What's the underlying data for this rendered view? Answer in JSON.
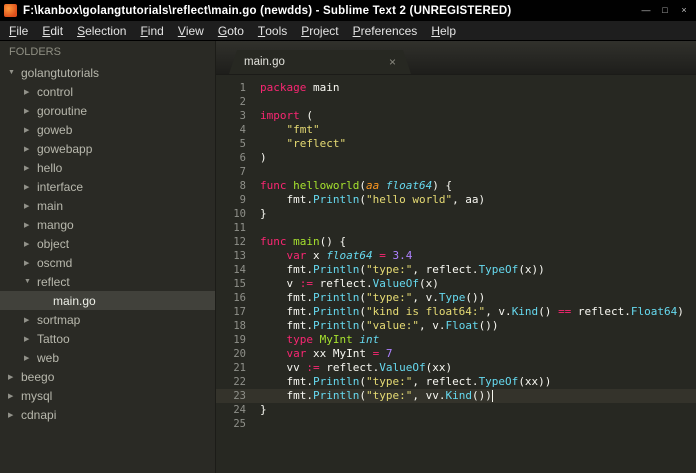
{
  "window": {
    "title": "F:\\kanbox\\golangtutorials\\reflect\\main.go (newdds) - Sublime Text 2 (UNREGISTERED)",
    "controls": {
      "minimize": "—",
      "maximize": "□",
      "close": "×"
    }
  },
  "menu": {
    "items": [
      "File",
      "Edit",
      "Selection",
      "Find",
      "View",
      "Goto",
      "Tools",
      "Project",
      "Preferences",
      "Help"
    ]
  },
  "sidebar": {
    "header": "FOLDERS",
    "items": [
      {
        "label": "golangtutorials",
        "depth": 0,
        "arrow": "down",
        "selected": false
      },
      {
        "label": "control",
        "depth": 1,
        "arrow": "right",
        "selected": false
      },
      {
        "label": "goroutine",
        "depth": 1,
        "arrow": "right",
        "selected": false
      },
      {
        "label": "goweb",
        "depth": 1,
        "arrow": "right",
        "selected": false
      },
      {
        "label": "gowebapp",
        "depth": 1,
        "arrow": "right",
        "selected": false
      },
      {
        "label": "hello",
        "depth": 1,
        "arrow": "right",
        "selected": false
      },
      {
        "label": "interface",
        "depth": 1,
        "arrow": "right",
        "selected": false
      },
      {
        "label": "main",
        "depth": 1,
        "arrow": "right",
        "selected": false
      },
      {
        "label": "mango",
        "depth": 1,
        "arrow": "right",
        "selected": false
      },
      {
        "label": "object",
        "depth": 1,
        "arrow": "right",
        "selected": false
      },
      {
        "label": "oscmd",
        "depth": 1,
        "arrow": "right",
        "selected": false
      },
      {
        "label": "reflect",
        "depth": 1,
        "arrow": "down",
        "selected": false
      },
      {
        "label": "main.go",
        "depth": 2,
        "arrow": "none",
        "selected": true
      },
      {
        "label": "sortmap",
        "depth": 1,
        "arrow": "right",
        "selected": false
      },
      {
        "label": "Tattoo",
        "depth": 1,
        "arrow": "right",
        "selected": false
      },
      {
        "label": "web",
        "depth": 1,
        "arrow": "right",
        "selected": false
      },
      {
        "label": "beego",
        "depth": 0,
        "arrow": "right",
        "selected": false
      },
      {
        "label": "mysql",
        "depth": 0,
        "arrow": "right",
        "selected": false
      },
      {
        "label": "cdnapi",
        "depth": 0,
        "arrow": "right",
        "selected": false
      }
    ]
  },
  "tabbar": {
    "tabs": [
      {
        "label": "main.go",
        "close": "×",
        "active": true
      }
    ]
  },
  "editor": {
    "language": "go",
    "colors": {
      "background": "#272822",
      "keyword": "#f92672",
      "string": "#e6db74",
      "function_call": "#66d9ef",
      "type": "#66d9ef",
      "definition": "#a6e22e",
      "number": "#ae81ff",
      "parameter": "#fd971f",
      "text": "#f8f8f2",
      "line_numbers": "#8f908a"
    },
    "lines": [
      {
        "num": 1,
        "tokens": [
          [
            "pink",
            "package"
          ],
          [
            "plain",
            " main"
          ]
        ]
      },
      {
        "num": 2,
        "tokens": []
      },
      {
        "num": 3,
        "tokens": [
          [
            "pink",
            "import"
          ],
          [
            "plain",
            " ("
          ]
        ]
      },
      {
        "num": 4,
        "tokens": [
          [
            "plain",
            "    "
          ],
          [
            "str",
            "\"fmt\""
          ]
        ]
      },
      {
        "num": 5,
        "tokens": [
          [
            "plain",
            "    "
          ],
          [
            "str",
            "\"reflect\""
          ]
        ]
      },
      {
        "num": 6,
        "tokens": [
          [
            "plain",
            ")"
          ]
        ]
      },
      {
        "num": 7,
        "tokens": []
      },
      {
        "num": 8,
        "tokens": [
          [
            "pink",
            "func"
          ],
          [
            "green",
            " helloworld"
          ],
          [
            "plain",
            "("
          ],
          [
            "orange",
            "aa"
          ],
          [
            "plain",
            " "
          ],
          [
            "ital",
            "float64"
          ],
          [
            "plain",
            ") {"
          ]
        ]
      },
      {
        "num": 9,
        "tokens": [
          [
            "plain",
            "    fmt."
          ],
          [
            "cyan",
            "Println"
          ],
          [
            "plain",
            "("
          ],
          [
            "str",
            "\"hello world\""
          ],
          [
            "plain",
            ", aa)"
          ]
        ]
      },
      {
        "num": 10,
        "tokens": [
          [
            "plain",
            "}"
          ]
        ]
      },
      {
        "num": 11,
        "tokens": []
      },
      {
        "num": 12,
        "tokens": [
          [
            "pink",
            "func"
          ],
          [
            "green",
            " main"
          ],
          [
            "plain",
            "() {"
          ]
        ]
      },
      {
        "num": 13,
        "tokens": [
          [
            "plain",
            "    "
          ],
          [
            "pink",
            "var"
          ],
          [
            "plain",
            " x "
          ],
          [
            "ital",
            "float64"
          ],
          [
            "plain",
            " "
          ],
          [
            "pink",
            "="
          ],
          [
            "plain",
            " "
          ],
          [
            "num",
            "3.4"
          ]
        ]
      },
      {
        "num": 14,
        "tokens": [
          [
            "plain",
            "    fmt."
          ],
          [
            "cyan",
            "Println"
          ],
          [
            "plain",
            "("
          ],
          [
            "str",
            "\"type:\""
          ],
          [
            "plain",
            ", reflect."
          ],
          [
            "cyan",
            "TypeOf"
          ],
          [
            "plain",
            "(x))"
          ]
        ]
      },
      {
        "num": 15,
        "tokens": [
          [
            "plain",
            "    v "
          ],
          [
            "pink",
            ":="
          ],
          [
            "plain",
            " reflect."
          ],
          [
            "cyan",
            "ValueOf"
          ],
          [
            "plain",
            "(x)"
          ]
        ]
      },
      {
        "num": 16,
        "tokens": [
          [
            "plain",
            "    fmt."
          ],
          [
            "cyan",
            "Println"
          ],
          [
            "plain",
            "("
          ],
          [
            "str",
            "\"type:\""
          ],
          [
            "plain",
            ", v."
          ],
          [
            "cyan",
            "Type"
          ],
          [
            "plain",
            "())"
          ]
        ]
      },
      {
        "num": 17,
        "tokens": [
          [
            "plain",
            "    fmt."
          ],
          [
            "cyan",
            "Println"
          ],
          [
            "plain",
            "("
          ],
          [
            "str",
            "\"kind is float64:\""
          ],
          [
            "plain",
            ", v."
          ],
          [
            "cyan",
            "Kind"
          ],
          [
            "plain",
            "() "
          ],
          [
            "pink",
            "=="
          ],
          [
            "plain",
            " reflect."
          ],
          [
            "cyan",
            "Float64"
          ],
          [
            "plain",
            ")"
          ]
        ]
      },
      {
        "num": 18,
        "tokens": [
          [
            "plain",
            "    fmt."
          ],
          [
            "cyan",
            "Println"
          ],
          [
            "plain",
            "("
          ],
          [
            "str",
            "\"value:\""
          ],
          [
            "plain",
            ", v."
          ],
          [
            "cyan",
            "Float"
          ],
          [
            "plain",
            "())"
          ]
        ]
      },
      {
        "num": 19,
        "tokens": [
          [
            "plain",
            "    "
          ],
          [
            "pink",
            "type"
          ],
          [
            "green",
            " MyInt"
          ],
          [
            "plain",
            " "
          ],
          [
            "ital",
            "int"
          ]
        ]
      },
      {
        "num": 20,
        "tokens": [
          [
            "plain",
            "    "
          ],
          [
            "pink",
            "var"
          ],
          [
            "plain",
            " xx MyInt "
          ],
          [
            "pink",
            "="
          ],
          [
            "plain",
            " "
          ],
          [
            "num",
            "7"
          ]
        ]
      },
      {
        "num": 21,
        "tokens": [
          [
            "plain",
            "    vv "
          ],
          [
            "pink",
            ":="
          ],
          [
            "plain",
            " reflect."
          ],
          [
            "cyan",
            "ValueOf"
          ],
          [
            "plain",
            "(xx)"
          ]
        ]
      },
      {
        "num": 22,
        "tokens": [
          [
            "plain",
            "    fmt."
          ],
          [
            "cyan",
            "Println"
          ],
          [
            "plain",
            "("
          ],
          [
            "str",
            "\"type:\""
          ],
          [
            "plain",
            ", reflect."
          ],
          [
            "cyan",
            "TypeOf"
          ],
          [
            "plain",
            "(xx))"
          ]
        ]
      },
      {
        "num": 23,
        "current": true,
        "cursor": true,
        "tokens": [
          [
            "plain",
            "    fmt."
          ],
          [
            "cyan",
            "Println"
          ],
          [
            "plain",
            "("
          ],
          [
            "str",
            "\"type:\""
          ],
          [
            "plain",
            ", vv."
          ],
          [
            "cyan",
            "Kind"
          ],
          [
            "plain",
            "())"
          ]
        ]
      },
      {
        "num": 24,
        "tokens": [
          [
            "plain",
            "}"
          ]
        ]
      },
      {
        "num": 25,
        "tokens": []
      }
    ]
  }
}
